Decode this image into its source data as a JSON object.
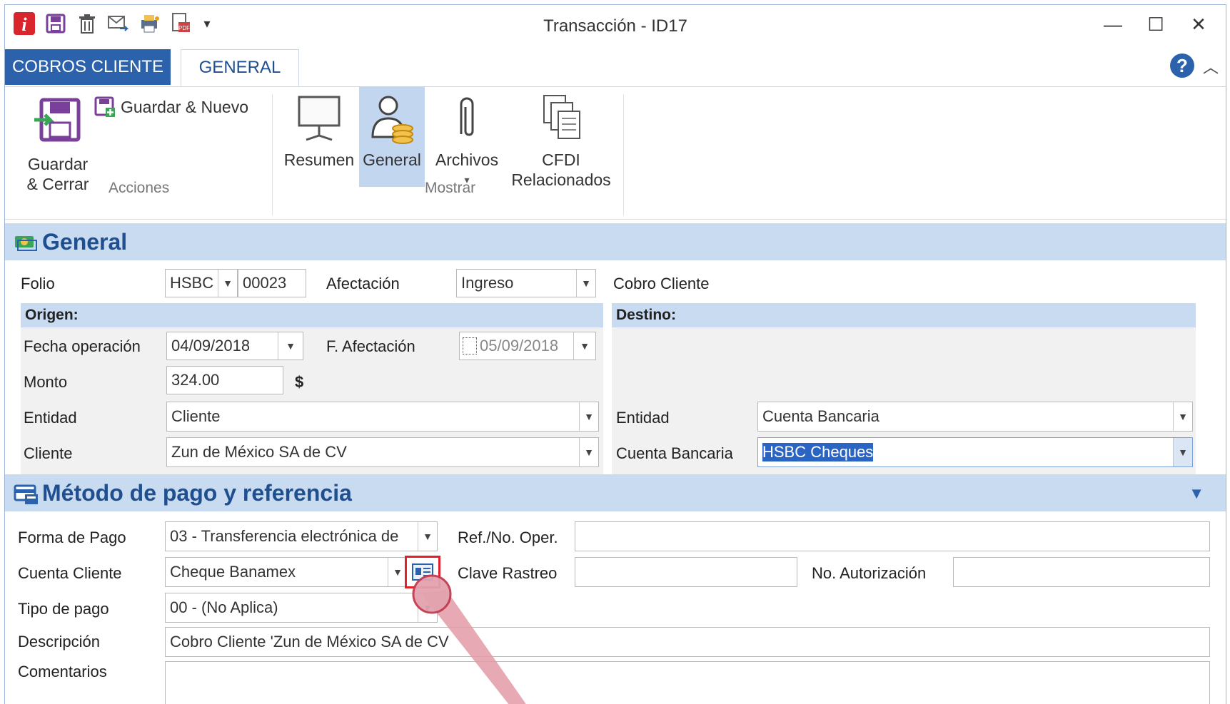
{
  "window": {
    "title": "Transacción - ID17",
    "buttons": {
      "minimize": "—",
      "maximize": "☐",
      "close": "✕"
    }
  },
  "ribbon": {
    "tabs": [
      "COBROS CLIENTE",
      "GENERAL"
    ],
    "help": "?",
    "acciones": {
      "label": "Acciones",
      "guardar_cerrar": [
        "Guardar",
        "& Cerrar"
      ],
      "guardar_nuevo": "Guardar & Nuevo"
    },
    "mostrar": {
      "label": "Mostrar",
      "resumen": "Resumen",
      "general": "General",
      "archivos": "Archivos",
      "cfdi": [
        "CFDI",
        "Relacionados"
      ]
    }
  },
  "general": {
    "title": "General",
    "folio_label": "Folio",
    "folio_serie": "HSBC",
    "folio_num": "00023",
    "afectacion_label": "Afectación",
    "afectacion_value": "Ingreso",
    "cobro_cliente": "Cobro Cliente",
    "origen": {
      "title": "Origen:",
      "fecha_label": "Fecha operación",
      "fecha_value": "04/09/2018",
      "f_afectacion_label": "F. Afectación",
      "f_afectacion_value": "05/09/2018",
      "monto_label": "Monto",
      "monto_value": "324.00",
      "currency": "$",
      "entidad_label": "Entidad",
      "entidad_value": "Cliente",
      "cliente_label": "Cliente",
      "cliente_value": "Zun de México SA de CV"
    },
    "destino": {
      "title": "Destino:",
      "entidad_label": "Entidad",
      "entidad_value": "Cuenta Bancaria",
      "cuenta_label": "Cuenta Bancaria",
      "cuenta_value": "HSBC Cheques"
    }
  },
  "metodo": {
    "title": "Método de pago y referencia",
    "forma_label": "Forma de Pago",
    "forma_value": "03 - Transferencia electrónica de",
    "ref_label": "Ref./No. Oper.",
    "ref_value": "",
    "cuenta_cliente_label": "Cuenta Cliente",
    "cuenta_cliente_value": "Cheque Banamex",
    "clave_label": "Clave Rastreo",
    "clave_value": "",
    "autorizacion_label": "No. Autorización",
    "autorizacion_value": "",
    "tipo_label": "Tipo de pago",
    "tipo_value": "00 - (No Aplica)",
    "descripcion_label": "Descripción",
    "descripcion_value": "Cobro Cliente 'Zun de México SA de CV",
    "comentarios_label": "Comentarios",
    "comentarios_value": ""
  },
  "colors": {
    "accent": "#2b62ab",
    "section_bg": "#c8dbf1",
    "highlight": "#e0202a"
  }
}
